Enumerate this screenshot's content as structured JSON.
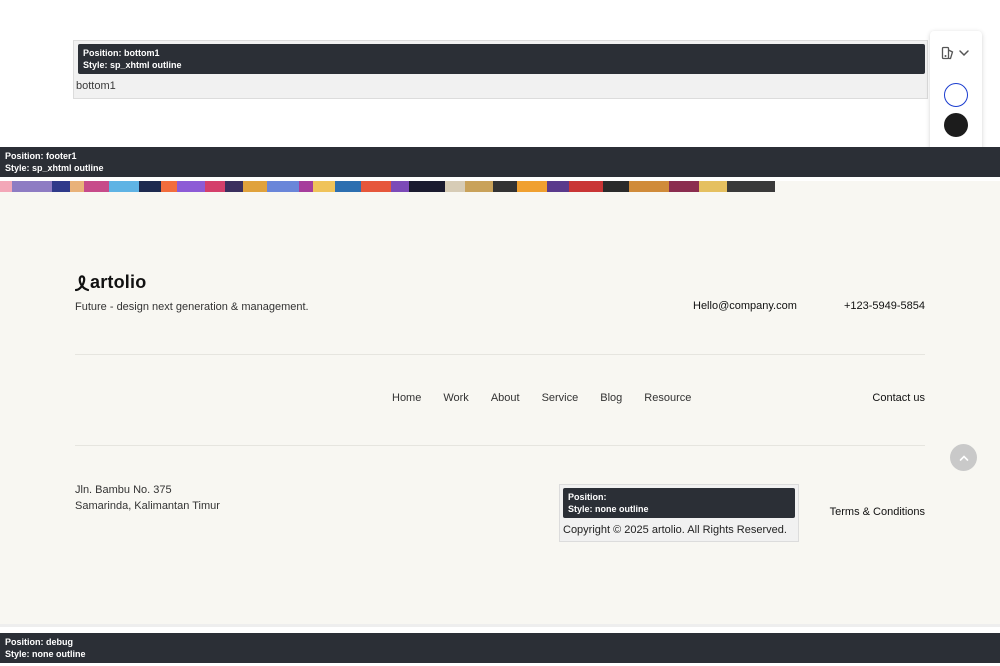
{
  "bottom1": {
    "debug_position": "Position: bottom1",
    "debug_style": "Style: sp_xhtml outline",
    "content": "bottom1"
  },
  "switcher": {
    "toggle_icon": "palette-icon",
    "chevron_icon": "chevron-down-icon",
    "swatches": [
      {
        "name": "light",
        "color": "#ffffff",
        "border": "#1a3ccf"
      },
      {
        "name": "dark",
        "color": "#1c1c1c"
      }
    ]
  },
  "footer1": {
    "debug_position": "Position: footer1",
    "debug_style": "Style: sp_xhtml outline"
  },
  "gallery": {
    "colors": [
      "#f3a7b8",
      "#8e7cc3",
      "#2f3a8a",
      "#e9b27a",
      "#c74b8a",
      "#5fb3e4",
      "#1e2a4f",
      "#f26d3d",
      "#8d5bd6",
      "#d43f6b",
      "#3b2f5e",
      "#e0a23c",
      "#6a86d9",
      "#a63d9c",
      "#f0c35a",
      "#2d6fb0",
      "#e6573b",
      "#7c4ab8",
      "#1b1b2f",
      "#d7ccb6",
      "#c9a25a",
      "#333333",
      "#f0a030",
      "#5a3a8c",
      "#c93535",
      "#2b2b2b",
      "#d08b3a",
      "#8b2d4f",
      "#e5c060",
      "#3a3a3a"
    ]
  },
  "footer": {
    "brand_name": "artolio",
    "tagline": "Future - design next generation & management.",
    "email": "Hello@company.com",
    "phone": "+123-5949-5854",
    "nav": [
      "Home",
      "Work",
      "About",
      "Service",
      "Blog",
      "Resource"
    ],
    "contact": "Contact us",
    "address_line1": "Jln. Bambu No. 375",
    "address_line2": "Samarinda, Kalimantan Timur",
    "copyright_debug_position": "Position:",
    "copyright_debug_style": "Style: none outline",
    "copyright": "Copyright © 2025 artolio. All Rights Reserved.",
    "terms": "Terms & Conditions",
    "background": "#f8f7f2"
  },
  "debug": {
    "debug_position": "Position: debug",
    "debug_style": "Style: none outline"
  },
  "colors": {
    "debug_label_bg": "#2b2f36",
    "accent_blue": "#1a3ccf",
    "scroll_button": "#c9c9c9"
  }
}
